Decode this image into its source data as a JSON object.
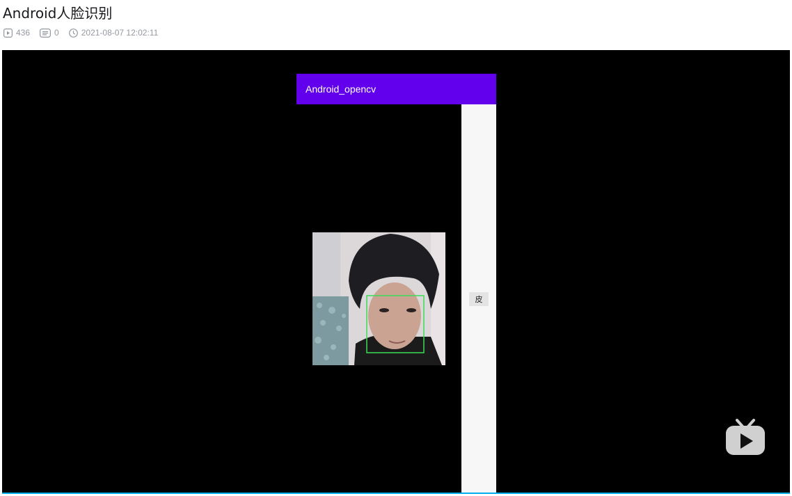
{
  "header": {
    "title": "Android人脸识别",
    "views": "436",
    "danmaku": "0",
    "publish_time": "2021-08-07 12:02:11",
    "icons": [
      "play-count-icon",
      "danmaku-icon",
      "clock-icon"
    ]
  },
  "player": {
    "app_title": "Android_opencv",
    "side_button_label": "皮",
    "logo_icon": "bilibili-tv-icon",
    "colors": {
      "app_bar": "#6200ee",
      "face_box": "#3ddc57",
      "progress": "#00aeec",
      "side_panel": "#f7f7f7"
    }
  }
}
